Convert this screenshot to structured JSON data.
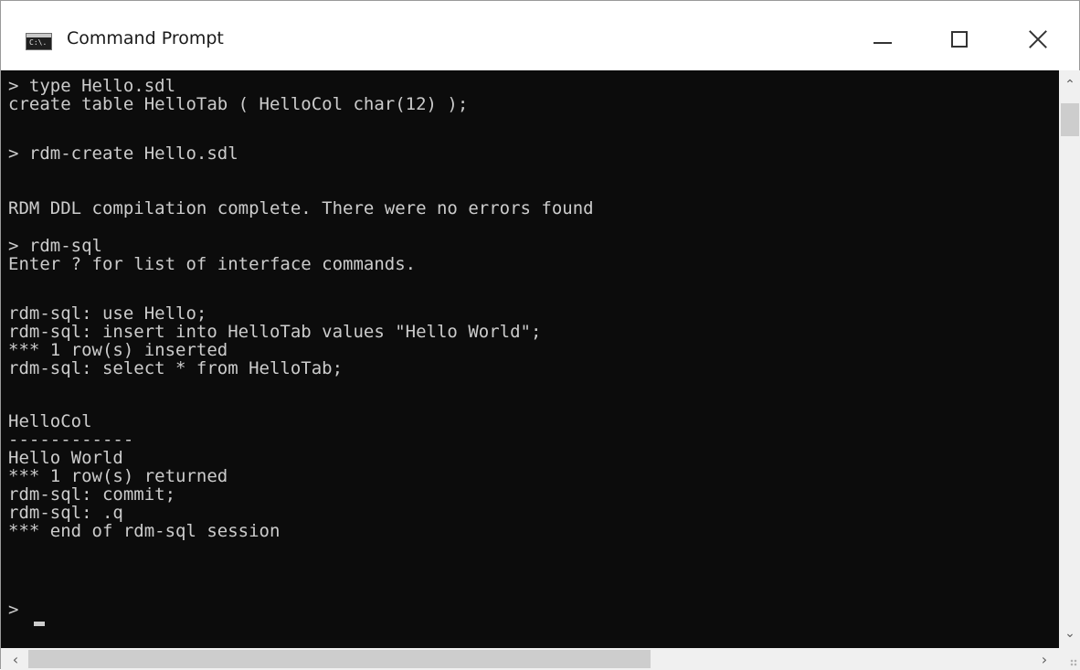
{
  "window": {
    "title": "Command Prompt",
    "icon": "cmd-icon",
    "icon_text": "C:\\.",
    "controls": {
      "minimize": "minimize-icon",
      "maximize": "maximize-icon",
      "close": "close-icon"
    }
  },
  "console": {
    "lines": [
      "> type Hello.sdl",
      "create table HelloTab ( HelloCol char(12) );",
      "",
      "> rdm-create Hello.sdl",
      "",
      "RDM DDL compilation complete. There were no errors found",
      "",
      "> rdm-sql",
      "Enter ? for list of interface commands.",
      "",
      "rdm-sql: use Hello;",
      "rdm-sql: insert into HelloTab values \"Hello World\";",
      "*** 1 row(s) inserted",
      "rdm-sql: select * from HelloTab;",
      "",
      "HelloCol",
      "------------",
      "Hello World",
      "*** 1 row(s) returned",
      "rdm-sql: commit;",
      "rdm-sql: .q",
      "*** end of rdm-sql session",
      "",
      ">"
    ]
  },
  "colors": {
    "console_bg": "#0c0c0c",
    "console_fg": "#cccccc",
    "titlebar_bg": "#ffffff",
    "scrollbar_bg": "#f0f0f0",
    "scrollbar_thumb": "#cdcdcd"
  },
  "scrollbars": {
    "up_icon": "scroll-up-arrow-icon",
    "down_icon": "scroll-down-arrow-icon",
    "left_icon": "scroll-left-arrow-icon",
    "right_icon": "scroll-right-arrow-icon"
  }
}
